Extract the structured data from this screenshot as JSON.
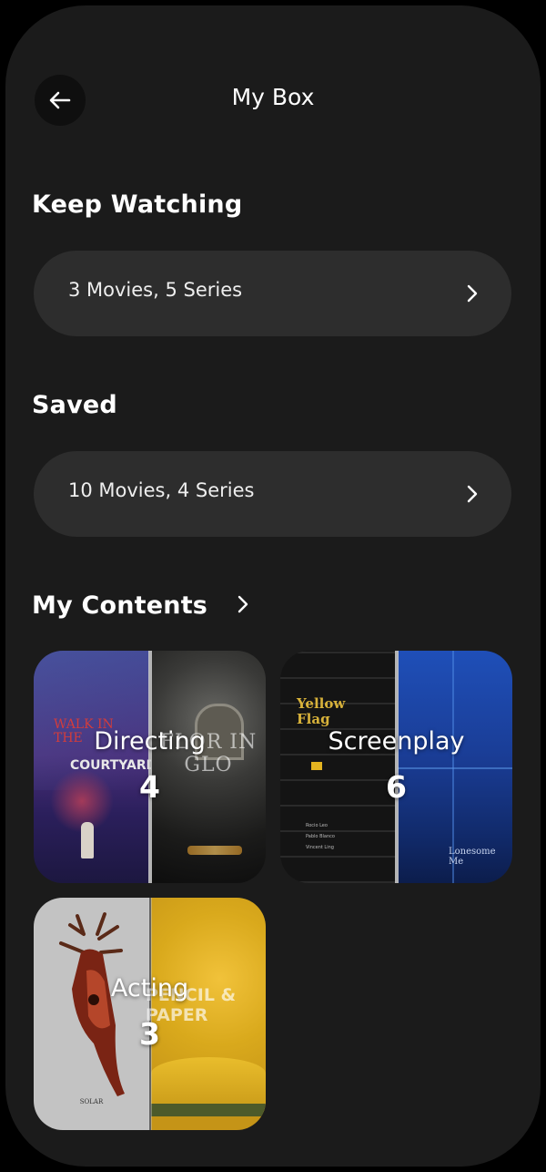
{
  "header": {
    "title": "My Box"
  },
  "keep_watching": {
    "heading": "Keep Watching",
    "summary": "3 Movies, 5 Series"
  },
  "saved": {
    "heading": "Saved",
    "summary": "10 Movies, 4 Series"
  },
  "contents": {
    "heading": "My Contents",
    "cards": [
      {
        "label": "Directing",
        "count": "4",
        "poster_left_title": "WALK IN THE",
        "poster_left_subtitle": "COURTYARD",
        "poster_right_title": "FLOR IN GLO"
      },
      {
        "label": "Screenplay",
        "count": "6",
        "poster_left_title": "Yellow Flag",
        "poster_left_credits": [
          "Rocio Leo",
          "Pablo Blanco",
          "Vincent Ling"
        ],
        "poster_right_title": "Lonesome Me"
      },
      {
        "label": "Acting",
        "count": "3",
        "poster_left_title": "SOLAR",
        "poster_right_title": "PENCIL & PAPER"
      }
    ]
  },
  "colors": {
    "background": "#1b1b1b",
    "pill": "#2d2d2d",
    "accent_yellow": "#e3b320",
    "accent_blue": "#1f4fb8"
  }
}
